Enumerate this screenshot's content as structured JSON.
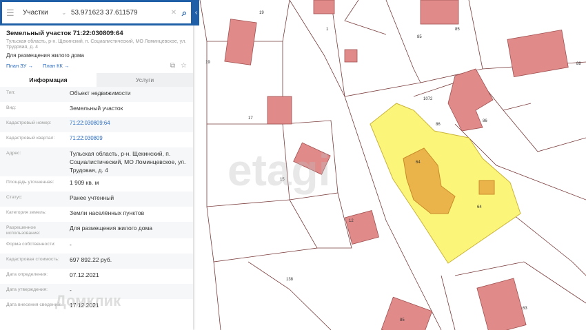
{
  "search": {
    "layer": "Участки",
    "query": "53.971623 37.611579"
  },
  "parcel": {
    "title": "Земельный участок 71:22:030809:64",
    "address": "Тульская область, р-н. Щекинский, п. Социалистический, МО Ломинцевское, ул. Трудовая, д. 4",
    "purpose": "Для размещения жилого дома",
    "links": [
      "План ЗУ →",
      "План КК →"
    ]
  },
  "tabs": [
    "Информация",
    "Услуги"
  ],
  "info": [
    {
      "label": "Тип:",
      "value": "Объект недвижимости"
    },
    {
      "label": "Вид:",
      "value": "Земельный участок"
    },
    {
      "label": "Кадастровый номер:",
      "value": "71:22:030809:64"
    },
    {
      "label": "Кадастровый квартал:",
      "value": "71:22:030809"
    },
    {
      "label": "Адрес:",
      "value": "Тульская область, р-н. Щекинский, п. Социалистический, МО Ломинцевское, ул. Трудовая, д. 4"
    },
    {
      "label": "Площадь уточненная:",
      "value": "1 909 кв. м"
    },
    {
      "label": "Статус:",
      "value": "Ранее учтенный"
    },
    {
      "label": "Категория земель:",
      "value": "Земли населённых пунктов"
    },
    {
      "label": "Разрешенное использование:",
      "value": "Для размещения жилого дома"
    },
    {
      "label": "Форма собственности:",
      "value": "-"
    },
    {
      "label": "Кадастровая стоимость:",
      "value": "697 892.22 руб."
    },
    {
      "label": "Дата определения:",
      "value": "07.12.2021"
    },
    {
      "label": "Дата утверждения:",
      "value": "-"
    },
    {
      "label": "Дата внесения сведений:",
      "value": "17.12.2021"
    }
  ],
  "watermarks": {
    "panel": "Домклик",
    "map": "etagi"
  },
  "map_labels": [
    "19",
    "1",
    "85",
    "85",
    "88",
    "19",
    "17",
    "15",
    "12",
    "138",
    "1072",
    "86",
    "86",
    "64",
    "64",
    "63",
    "85"
  ],
  "colors": {
    "accent": "#1f5fa8",
    "building": "#e08a8a",
    "selected": "#fbf57a",
    "selected_building": "#eab44a"
  }
}
